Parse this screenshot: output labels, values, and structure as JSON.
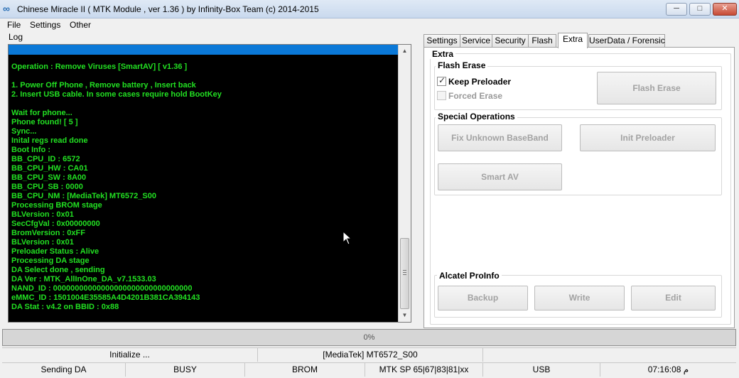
{
  "window": {
    "title": "Chinese Miracle II ( MTK Module , ver 1.36 ) by Infinity-Box Team (c) 2014-2015",
    "controls": {
      "minimize": "─",
      "maximize": "□",
      "close": "✕"
    }
  },
  "menu": [
    "File",
    "Settings",
    "Other"
  ],
  "log": {
    "label": "Log",
    "lines": [
      "Operation : Remove Viruses [SmartAV] [ v1.36 ]",
      "",
      "1. Power Off Phone , Remove battery , Insert back",
      "2. Insert USB cable. In some cases require hold BootKey",
      "",
      "Wait for phone...",
      "Phone found! [ 5 ]",
      "Sync...",
      "Inital regs read done",
      "Boot Info :",
      "BB_CPU_ID : 6572",
      "BB_CPU_HW : CA01",
      "BB_CPU_SW : 8A00",
      "BB_CPU_SB : 0000",
      "BB_CPU_NM : [MediaTek] MT6572_S00",
      "Processing BROM stage",
      "BLVersion : 0x01",
      "SecCfgVal : 0x00000000",
      "BromVersion : 0xFF",
      "BLVersion : 0x01",
      "Preloader Status : Alive",
      "Processing DA stage",
      "DA Select done , sending",
      "DA Ver : MTK_AllInOne_DA_v7.1533.03",
      "NAND_ID : 00000000000000000000000000000000",
      "eMMC_ID : 1501004E35585A4D4201B381CA394143",
      "DA Stat : v4.2 on BBID : 0x88"
    ]
  },
  "tabs": [
    "Settings",
    "Service",
    "Security",
    "Flash",
    "Extra",
    "UserData / Forensic"
  ],
  "active_tab": "Extra",
  "extra": {
    "panel_title": "Extra",
    "flash_erase": {
      "title": "Flash Erase",
      "keep_preloader": {
        "label": "Keep Preloader",
        "checked": true
      },
      "forced_erase": {
        "label": "Forced Erase",
        "checked": false
      },
      "button": "Flash Erase"
    },
    "special_operations": {
      "title": "Special Operations",
      "fix_baseband": "Fix Unknown BaseBand",
      "init_preloader": "Init Preloader",
      "smart_av": "Smart AV"
    },
    "alcatel": {
      "title": "Alcatel ProInfo",
      "backup": "Backup",
      "write": "Write",
      "edit": "Edit"
    }
  },
  "progress": {
    "value": 0,
    "text": "0%"
  },
  "status_top": {
    "left": "Initialize ...",
    "middle": "[MediaTek] MT6572_S00",
    "right": ""
  },
  "status_bottom": [
    "Sending DA",
    "BUSY",
    "BROM",
    "MTK SP 65|67|83|81|xx",
    "USB",
    "07:16:08 م"
  ],
  "colors": {
    "log_text": "#22e022",
    "log_bg": "#000000",
    "selection": "#0a78d7",
    "progress": "#3cba3c"
  }
}
